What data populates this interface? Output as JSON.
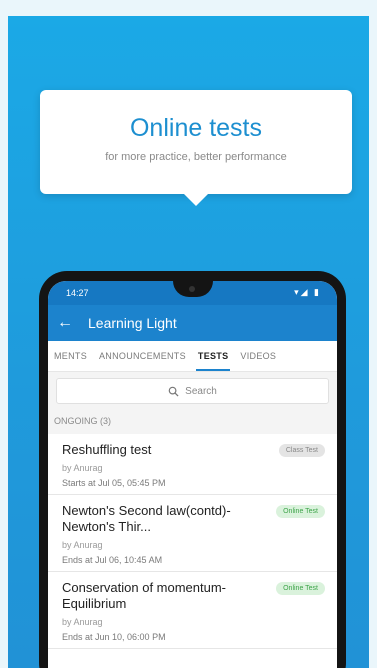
{
  "promo": {
    "title": "Online tests",
    "subtitle": "for more practice, better performance"
  },
  "status_bar": {
    "time": "14:27",
    "icons": "▾◢ ▮"
  },
  "app_bar": {
    "back_icon": "←",
    "title": "Learning Light"
  },
  "tabs": [
    {
      "label": "MENTS"
    },
    {
      "label": "ANNOUNCEMENTS"
    },
    {
      "label": "TESTS"
    },
    {
      "label": "VIDEOS"
    }
  ],
  "search": {
    "placeholder": "Search"
  },
  "section": {
    "label": "ONGOING (3)"
  },
  "tests": [
    {
      "title": "Reshuffling test",
      "by": "by Anurag",
      "time": "Starts at Jul 05, 05:45 PM",
      "badge": "Class Test"
    },
    {
      "title": "Newton's Second law(contd)-Newton's Thir...",
      "by": "by Anurag",
      "time": "Ends at Jul 06, 10:45 AM",
      "badge": "Online Test"
    },
    {
      "title": "Conservation of momentum-Equilibrium",
      "by": "by Anurag",
      "time": "Ends at Jun 10, 06:00 PM",
      "badge": "Online Test"
    }
  ]
}
